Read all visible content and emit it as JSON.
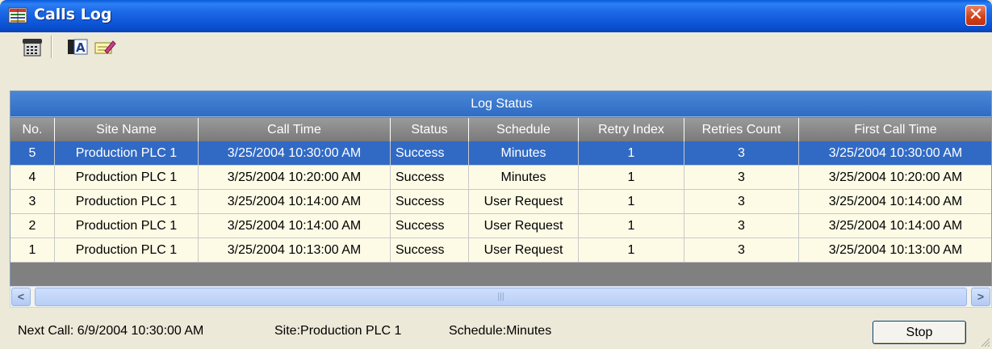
{
  "window": {
    "title": "Calls Log",
    "close_glyph": "✕"
  },
  "toolbar": {
    "icons": [
      "phone-icon",
      "font-icon",
      "edit-icon"
    ]
  },
  "grid": {
    "group_header": "Log Status",
    "columns": [
      "No.",
      "Site Name",
      "Call Time",
      "Status",
      "Schedule",
      "Retry Index",
      "Retries Count",
      "First Call Time"
    ],
    "rows": [
      [
        "5",
        "Production PLC 1",
        "3/25/2004 10:30:00 AM",
        "Success",
        "Minutes",
        "1",
        "3",
        "3/25/2004 10:30:00 AM"
      ],
      [
        "4",
        "Production PLC 1",
        "3/25/2004 10:20:00 AM",
        "Success",
        "Minutes",
        "1",
        "3",
        "3/25/2004 10:20:00 AM"
      ],
      [
        "3",
        "Production PLC 1",
        "3/25/2004 10:14:00 AM",
        "Success",
        "User Request",
        "1",
        "3",
        "3/25/2004 10:14:00 AM"
      ],
      [
        "2",
        "Production PLC 1",
        "3/25/2004 10:14:00 AM",
        "Success",
        "User Request",
        "1",
        "3",
        "3/25/2004 10:14:00 AM"
      ],
      [
        "1",
        "Production PLC 1",
        "3/25/2004 10:13:00 AM",
        "Success",
        "User Request",
        "1",
        "3",
        "3/25/2004 10:13:00 AM"
      ]
    ],
    "selected_row": 0
  },
  "scrollbar": {
    "left_arrow": "<",
    "right_arrow": ">",
    "thumb_grip": "|||"
  },
  "status_bar": {
    "next_call": "Next Call: 6/9/2004 10:30:00 AM",
    "site": "Site:Production PLC 1",
    "schedule": "Schedule:Minutes",
    "stop_label": "Stop"
  },
  "colors": {
    "selection": "#316ac5",
    "row_bg": "#fdfbe6",
    "header_bg": "#808080",
    "title_bar": "#0b52d4"
  }
}
